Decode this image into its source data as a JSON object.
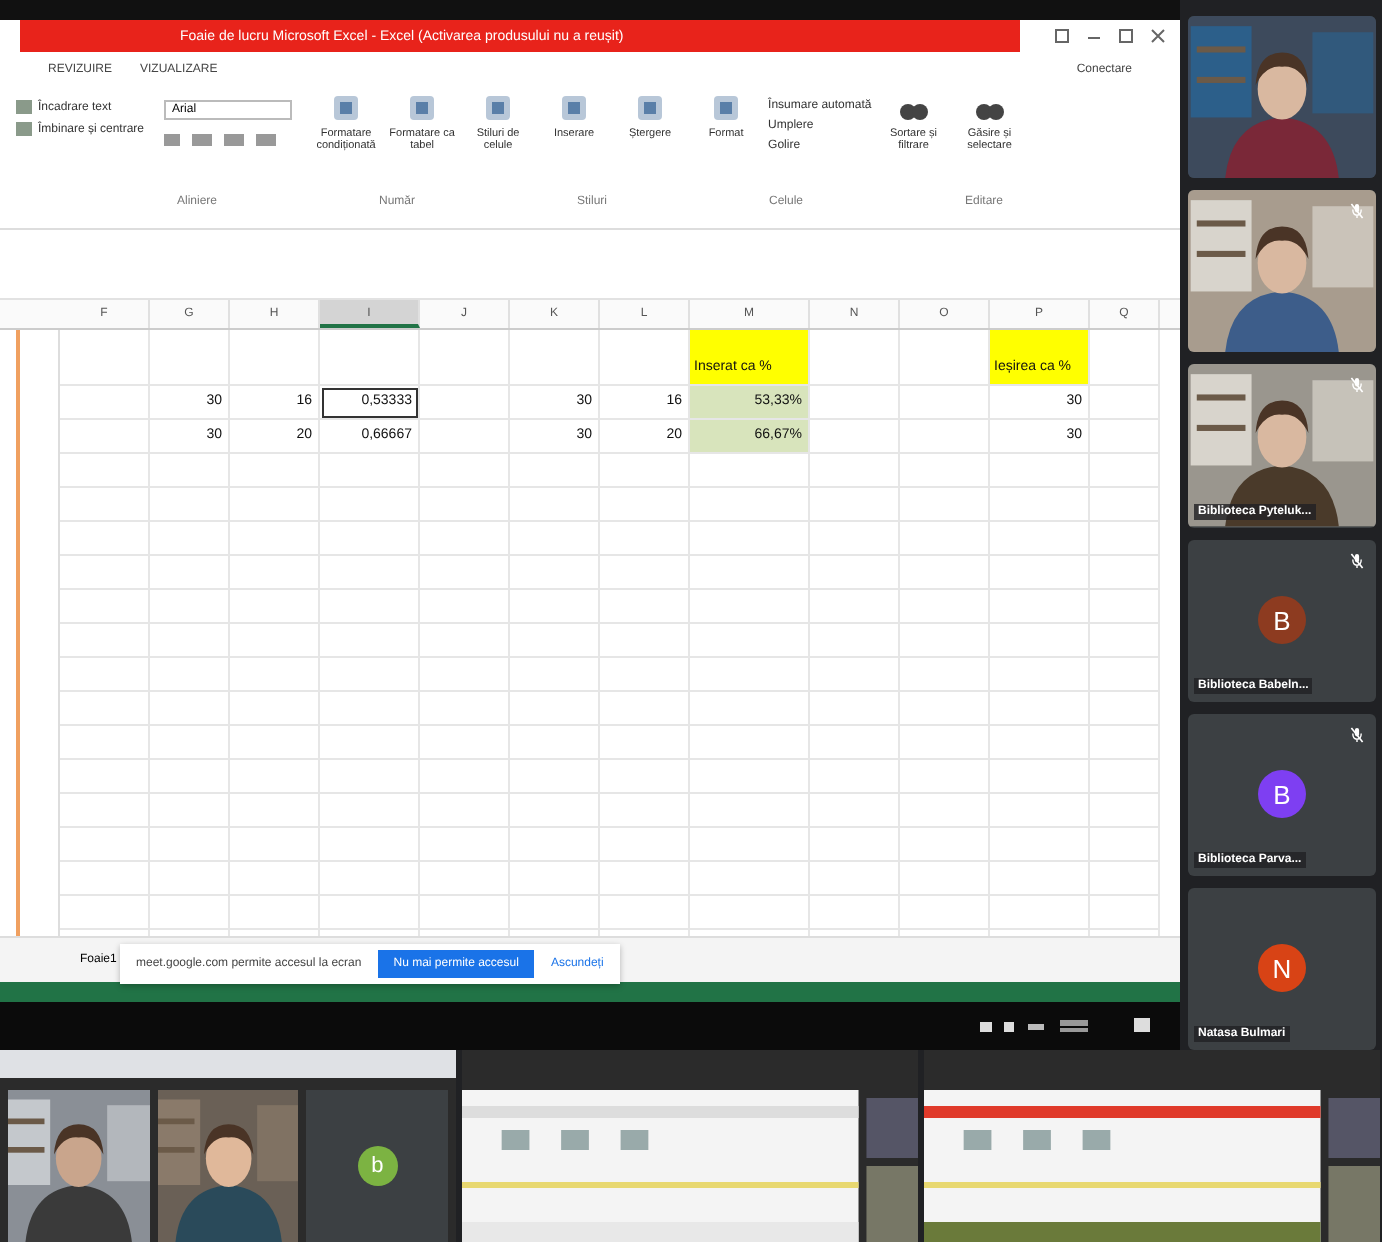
{
  "excel": {
    "title": "Foaie de lucru Microsoft Excel - Excel (Activarea produsului nu a reușit)",
    "ribbon_tabs": [
      {
        "label": "REVIZUIRE"
      },
      {
        "label": "VIZUALIZARE"
      }
    ],
    "account": "Conectare",
    "ribbon": {
      "wrap_text": "Încadrare text",
      "merge": "Îmbinare și centrare",
      "font": "Arial",
      "style_buttons": [
        {
          "label": "Formatare condiționată"
        },
        {
          "label": "Formatare ca tabel"
        },
        {
          "label": "Stiluri de celule"
        },
        {
          "label": "Inserare"
        },
        {
          "label": "Ștergere"
        },
        {
          "label": "Format"
        }
      ],
      "edit_items": [
        {
          "label": "Însumare automată"
        },
        {
          "label": "Umplere"
        },
        {
          "label": "Golire"
        }
      ],
      "find_buttons": [
        {
          "label": "Sortare și filtrare"
        },
        {
          "label": "Găsire și selectare"
        }
      ],
      "group_labels": [
        "Aliniere",
        "Număr",
        "Stiluri",
        "Celule",
        "Editare"
      ]
    },
    "columns": [
      {
        "label": "F",
        "selected": false
      },
      {
        "label": "G",
        "selected": false
      },
      {
        "label": "H",
        "selected": false
      },
      {
        "label": "I",
        "selected": true
      },
      {
        "label": "J",
        "selected": false
      },
      {
        "label": "K",
        "selected": false
      },
      {
        "label": "L",
        "selected": false
      },
      {
        "label": "M",
        "selected": false
      },
      {
        "label": "N",
        "selected": false
      },
      {
        "label": "O",
        "selected": false
      },
      {
        "label": "P",
        "selected": false
      },
      {
        "label": "Q",
        "selected": false
      }
    ],
    "rows": [
      {
        "kind": "header",
        "cells": {
          "m": {
            "text": "Inserat ca %",
            "color": "#ffff00",
            "selected": false
          },
          "p": {
            "text": "Ieșirea ca %",
            "color": "#ffff00",
            "selected": false
          }
        }
      },
      {
        "kind": "data",
        "cells": {
          "g": {
            "text": "30",
            "selected": false
          },
          "h": {
            "text": "16",
            "selected": false
          },
          "i": {
            "text": "0,53333",
            "selected": true
          },
          "k": {
            "text": "30",
            "selected": false
          },
          "l": {
            "text": "16",
            "selected": false
          },
          "m": {
            "text": "53,33%",
            "color": "#d8e4bc",
            "selected": false
          },
          "p": {
            "text": "30",
            "selected": false
          }
        }
      },
      {
        "kind": "data",
        "cells": {
          "g": {
            "text": "30",
            "selected": false
          },
          "h": {
            "text": "20",
            "selected": false
          },
          "i": {
            "text": "0,66667",
            "selected": false
          },
          "k": {
            "text": "30",
            "selected": false
          },
          "l": {
            "text": "20",
            "selected": false
          },
          "m": {
            "text": "66,67%",
            "color": "#d8e4bc",
            "selected": false
          },
          "p": {
            "text": "30",
            "selected": false
          }
        }
      }
    ],
    "sheet_tab": "Foaie1",
    "share_banner": {
      "message": "meet.google.com permite accesul la ecran",
      "stop_button": "Nu mai permite accesul",
      "hide_link": "Ascundeți"
    }
  },
  "participants": [
    {
      "kind": "video"
    },
    {
      "kind": "video",
      "muted": true
    },
    {
      "kind": "video",
      "name": "Biblioteca Pyteluk...",
      "muted": true
    },
    {
      "kind": "avatar",
      "initial": "B",
      "color": "#8d3b20",
      "name": "Biblioteca Babeln...",
      "muted": true
    },
    {
      "kind": "avatar",
      "initial": "B",
      "color": "#7e3ff2",
      "name": "Biblioteca Parva...",
      "muted": true
    },
    {
      "kind": "avatar",
      "initial": "N",
      "color": "#d84315",
      "name": "Natasa Bulmari",
      "muted": false
    }
  ],
  "thumbnails": [
    {
      "kind": "call",
      "initial": "b",
      "color": "#7cb342"
    },
    {
      "kind": "screen"
    },
    {
      "kind": "screen"
    }
  ]
}
